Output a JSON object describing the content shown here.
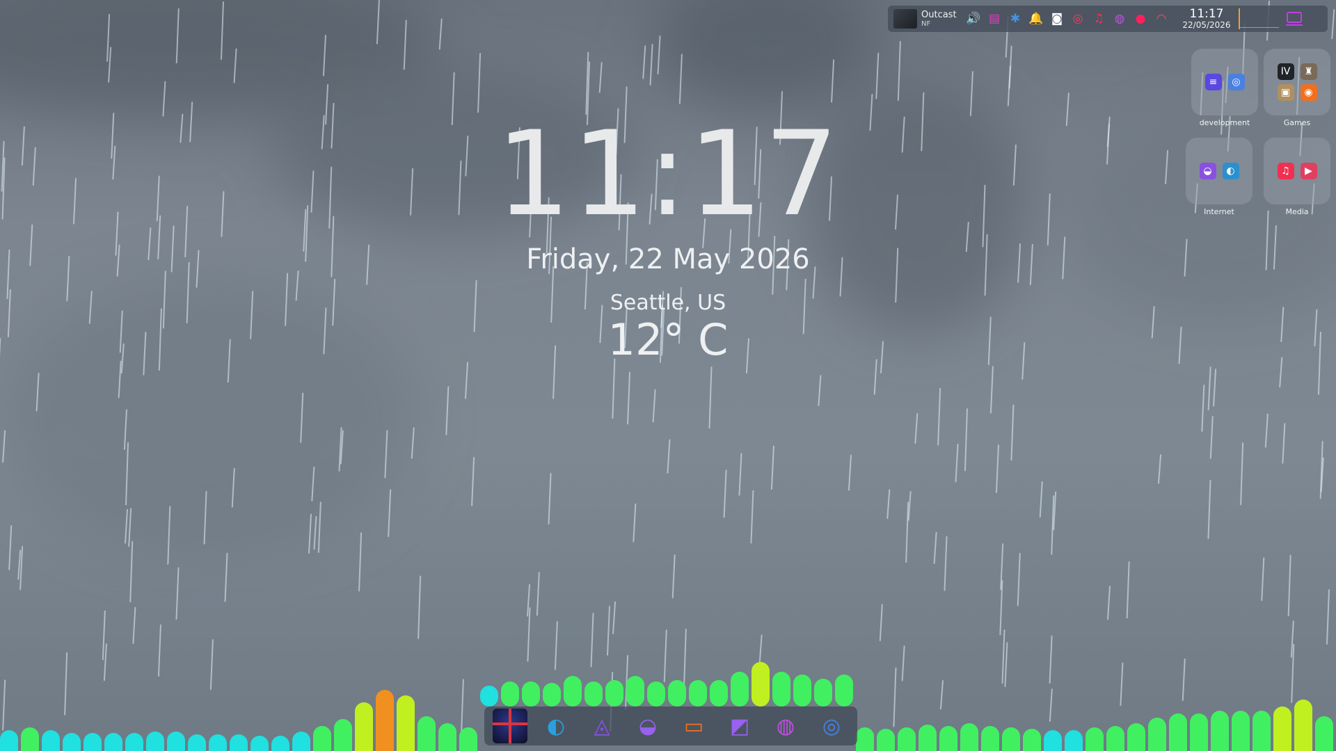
{
  "desktop": {
    "time": "11:17",
    "date_long": "Friday, 22 May 2026",
    "weather": {
      "city": "Seattle, US",
      "temperature": "12° C"
    }
  },
  "topbar": {
    "media": {
      "title": "Outcast",
      "subtitle": "NF"
    },
    "tray": [
      {
        "name": "volume-icon",
        "glyph": "🔊",
        "color": "#f0a030"
      },
      {
        "name": "calendar-icon",
        "glyph": "▤",
        "color": "#e040c0"
      },
      {
        "name": "bluetooth-icon",
        "glyph": "✱",
        "color": "#4a90e0"
      },
      {
        "name": "notification-bell-icon",
        "glyph": "🔔",
        "color": "#c040e0"
      },
      {
        "name": "discord-icon",
        "glyph": "◙",
        "color": "#ffffff"
      },
      {
        "name": "sync-icon",
        "glyph": "◎",
        "color": "#f04060"
      },
      {
        "name": "music-icon",
        "glyph": "♫",
        "color": "#ff3050"
      },
      {
        "name": "aperture-icon",
        "glyph": "◍",
        "color": "#c050e0"
      },
      {
        "name": "record-icon",
        "glyph": "●",
        "color": "#ff2060"
      },
      {
        "name": "speedometer-icon",
        "glyph": "◠",
        "color": "#f05060"
      }
    ],
    "clock": {
      "time": "11:17",
      "date": "22/05/2026"
    }
  },
  "folders": [
    {
      "label": "development",
      "icons": [
        {
          "name": "code-editor-icon",
          "glyph": "≡",
          "color": "#5a48e0"
        },
        {
          "name": "vscodium-icon",
          "glyph": "◎",
          "color": "#4a80e0"
        }
      ]
    },
    {
      "label": "Games",
      "icons": [
        {
          "name": "game-iv-icon",
          "glyph": "IV",
          "color": "#202428"
        },
        {
          "name": "game-castle-icon",
          "glyph": "♜",
          "color": "#7a6a58"
        },
        {
          "name": "game-map-icon",
          "glyph": "▣",
          "color": "#b09060"
        },
        {
          "name": "game-orange-icon",
          "glyph": "◉",
          "color": "#f07020"
        }
      ]
    },
    {
      "label": "Internet",
      "icons": [
        {
          "name": "gamepad-icon",
          "glyph": "◒",
          "color": "#8a50e0"
        },
        {
          "name": "edge-browser-icon",
          "glyph": "◐",
          "color": "#2a90d0"
        }
      ]
    },
    {
      "label": "Media",
      "icons": [
        {
          "name": "apple-music-icon",
          "glyph": "♫",
          "color": "#f03050"
        },
        {
          "name": "youtube-icon",
          "glyph": "▶",
          "color": "#e04060"
        }
      ]
    }
  ],
  "dock": [
    {
      "name": "avatar-launcher-icon",
      "glyph": "",
      "color": "#1b1f52"
    },
    {
      "name": "edge-browser-icon",
      "glyph": "◐",
      "color": "#2aa0e0"
    },
    {
      "name": "ai-assistant-icon",
      "glyph": "◬",
      "color": "#8a50f0"
    },
    {
      "name": "gamepad-icon",
      "glyph": "◒",
      "color": "#9a60f0"
    },
    {
      "name": "file-manager-icon",
      "glyph": "▭",
      "color": "#f07020"
    },
    {
      "name": "image-editor-icon",
      "glyph": "◩",
      "color": "#9a60f0"
    },
    {
      "name": "aperture-icon",
      "glyph": "◍",
      "color": "#c050e0"
    },
    {
      "name": "vscodium-icon",
      "glyph": "◎",
      "color": "#4a80e0"
    }
  ],
  "colors": {
    "viz_low": "#20e0e0",
    "viz_mid": "#40f060",
    "viz_high": "#c0f020",
    "viz_peak": "#f09020"
  }
}
